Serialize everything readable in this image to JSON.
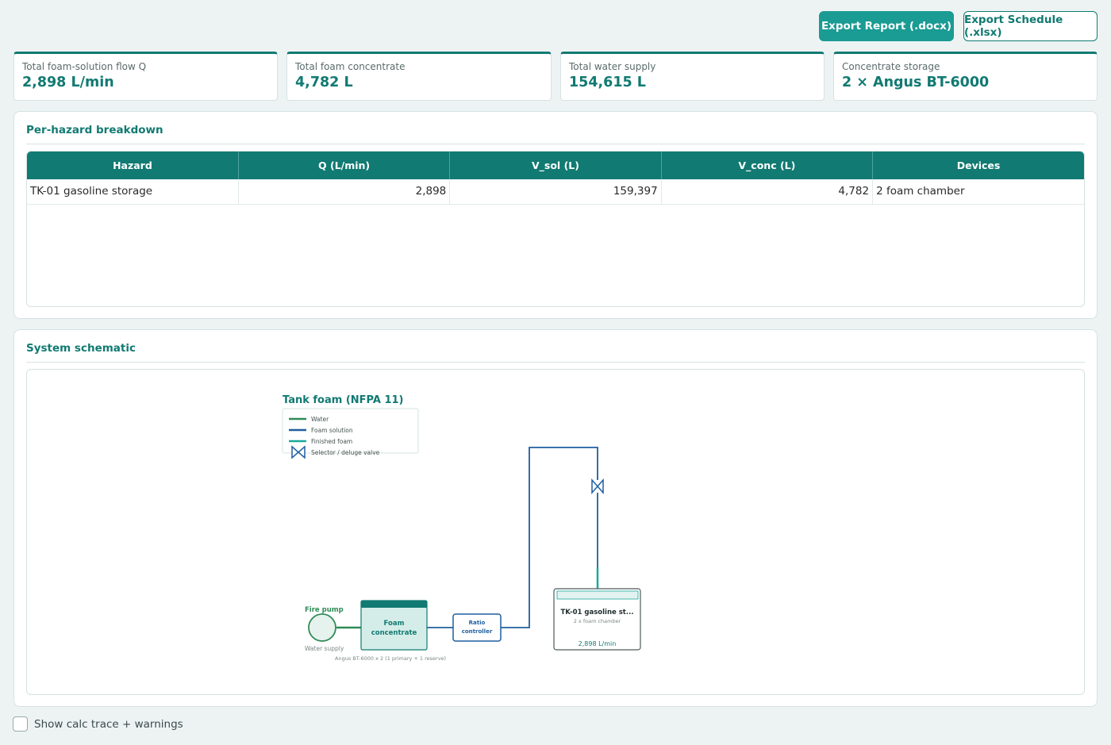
{
  "toolbar": {
    "export_report": "Export Report (.docx)",
    "export_schedule": "Export Schedule (.xlsx)"
  },
  "metrics": [
    {
      "label": "Total foam-solution flow Q",
      "value": "2,898 L/min"
    },
    {
      "label": "Total foam concentrate",
      "value": "4,782 L"
    },
    {
      "label": "Total water supply",
      "value": "154,615 L"
    },
    {
      "label": "Concentrate storage",
      "value": "2 × Angus BT-6000"
    }
  ],
  "breakdown": {
    "title": "Per-hazard breakdown",
    "columns": [
      "Hazard",
      "Q (L/min)",
      "V_sol (L)",
      "V_conc (L)",
      "Devices"
    ],
    "rows": [
      {
        "hazard": "TK-01 gasoline storage",
        "q": "2,898",
        "v_sol": "159,397",
        "v_conc": "4,782",
        "devices": "2 foam chamber"
      }
    ]
  },
  "schematic": {
    "panel_title": "System schematic",
    "diagram_title": "Tank foam (NFPA 11)",
    "legend": {
      "water": "Water",
      "foam_solution": "Foam solution",
      "finished_foam": "Finished foam",
      "valve": "Selector / deluge valve"
    },
    "pump_label": "Fire pump",
    "water_supply_label": "Water supply",
    "concentrate_line1": "Foam",
    "concentrate_line2": "concentrate",
    "concentrate_note": "Angus BT-6000  x 2  (1 primary + 1 reserve)",
    "ratio_line1": "Ratio",
    "ratio_line2": "controller",
    "tank_name": "TK-01 gasoline st...",
    "tank_devices": "2 x foam chamber",
    "tank_flow": "2,898 L/min",
    "colors": {
      "water": "#2e8b57",
      "foam_solution": "#1f5fa0",
      "finished_foam": "#1aa99c"
    }
  },
  "footer": {
    "calc_trace_label": "Show calc trace + warnings"
  }
}
